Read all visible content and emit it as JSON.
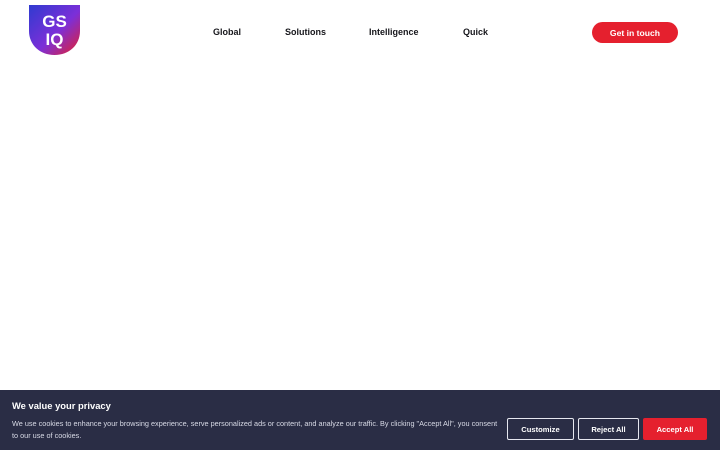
{
  "header": {
    "logo": {
      "icon": "gsiq-shield-logo",
      "lines": [
        "GS",
        "IQ"
      ],
      "colors": [
        "#2f3bd0",
        "#7c2fd8",
        "#e5202e"
      ]
    },
    "nav": {
      "items": [
        {
          "label": "Global"
        },
        {
          "label": "Solutions"
        },
        {
          "label": "Intelligence"
        },
        {
          "label": "Quick"
        }
      ]
    },
    "cta_label": "Get in touch"
  },
  "cookie_banner": {
    "title": "We value your privacy",
    "text": "We use cookies to enhance your browsing experience, serve personalized ads or content, and analyze our traffic. By clicking \"Accept All\", you consent to our use of cookies.",
    "customize_label": "Customize",
    "reject_label": "Reject All",
    "accept_label": "Accept All"
  },
  "colors": {
    "accent": "#e5202e",
    "banner_bg": "#2a2d45",
    "nav_text": "#16161b"
  }
}
